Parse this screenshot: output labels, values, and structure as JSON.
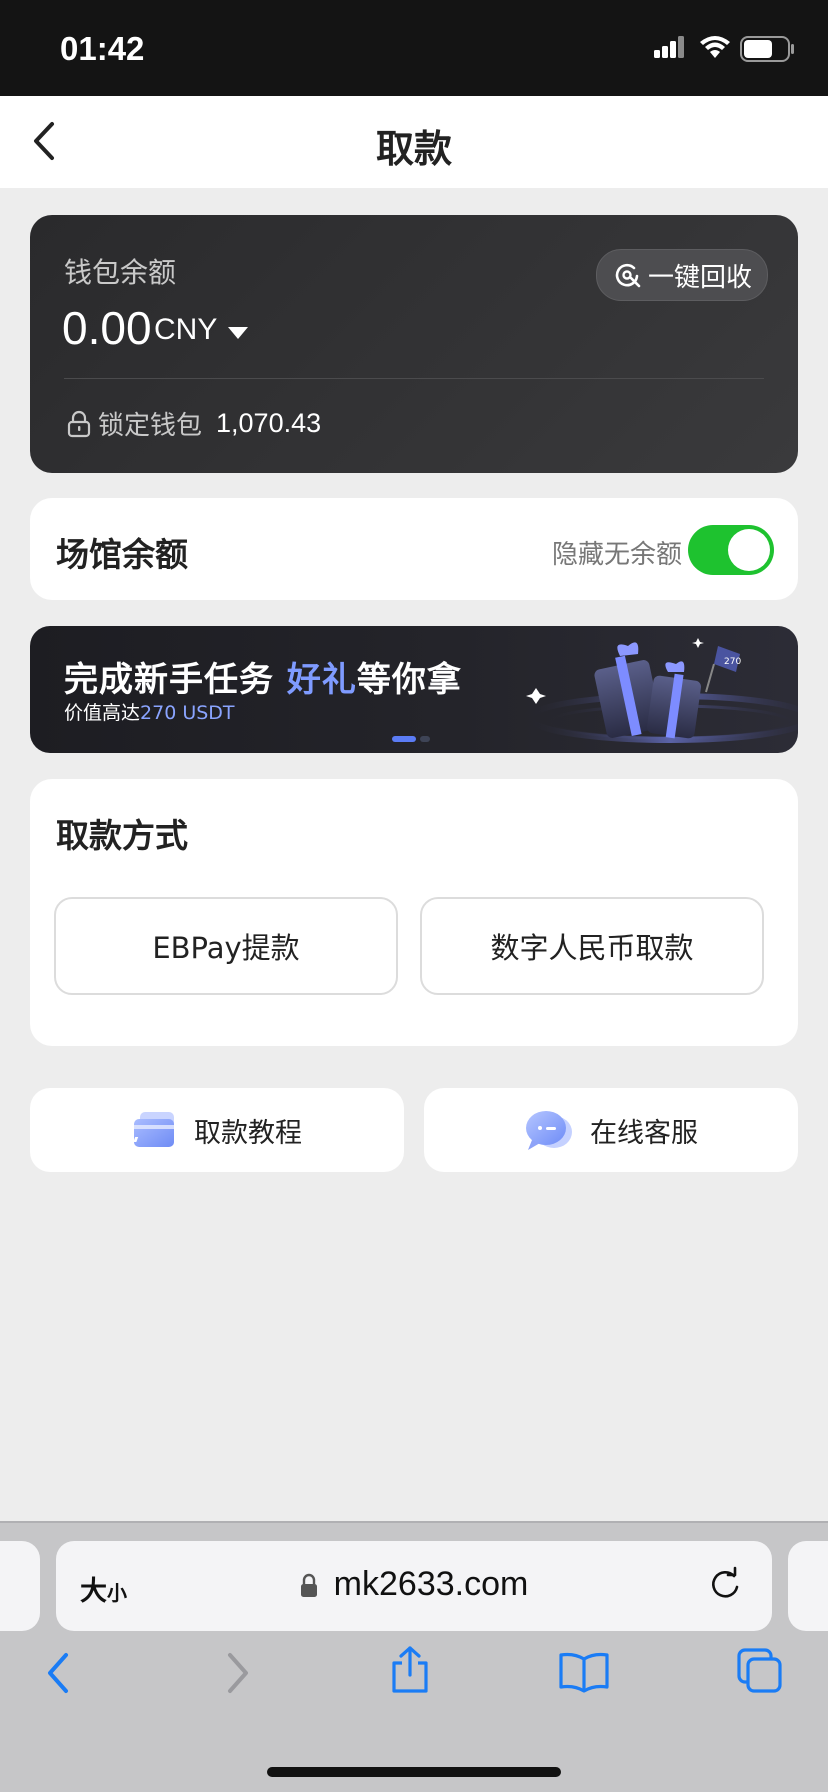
{
  "status_bar": {
    "time": "01:42"
  },
  "nav": {
    "title": "取款"
  },
  "wallet": {
    "label": "钱包余额",
    "amount": "0.00",
    "currency": "CNY",
    "recycle_label": "一键回收",
    "locked_label": "锁定钱包",
    "locked_amount": "1,070.43"
  },
  "venue": {
    "title": "场馆余额",
    "hide_label": "隐藏无余额",
    "hide_enabled": true
  },
  "banner": {
    "headline_part1": "完成新手任务 ",
    "headline_highlight": "好礼",
    "headline_part2": "等你拿",
    "sub_prefix": "价值高达",
    "sub_amount": "270 USDT",
    "gift_tag": "270",
    "slide_count": 2,
    "active_slide": 1
  },
  "method": {
    "title": "取款方式",
    "options": [
      "EBPay提款",
      "数字人民币取款"
    ]
  },
  "help": {
    "tutorial_label": "取款教程",
    "support_label": "在线客服"
  },
  "browser": {
    "text_size_label_big": "大",
    "text_size_label_small": "小",
    "url": "mk2633.com"
  },
  "colors": {
    "toggle_on": "#1ec22f",
    "accent_blue": "#7f9bff",
    "ios_blue": "#1a7cf5"
  }
}
